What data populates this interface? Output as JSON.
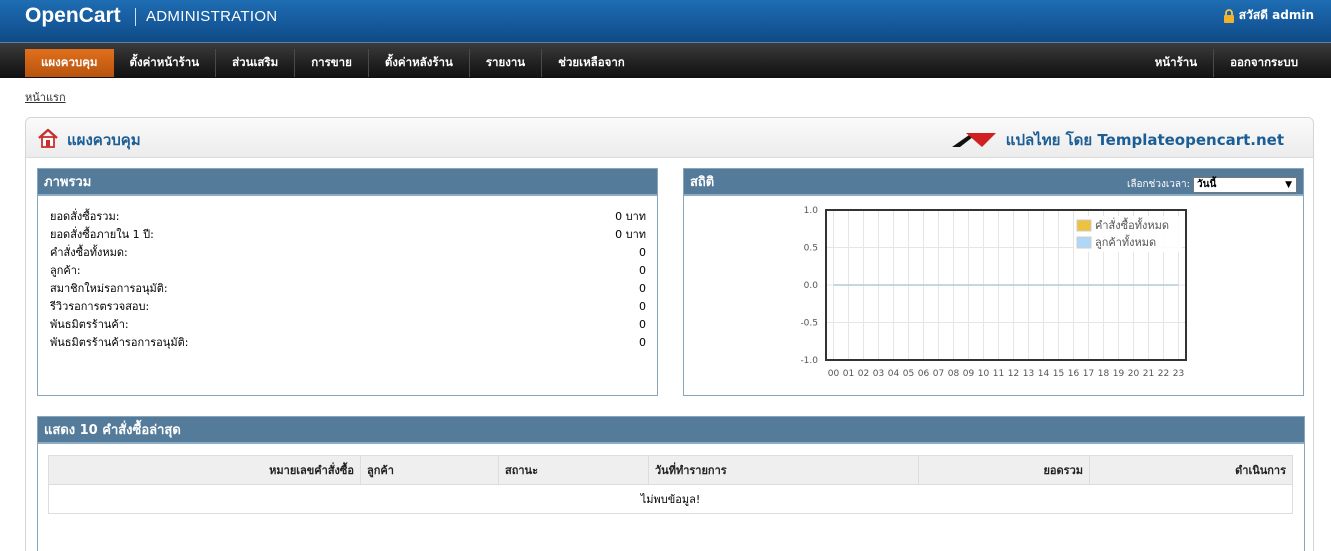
{
  "header": {
    "brand": "OpenCart",
    "subtitle": "ADMINISTRATION",
    "user_greeting": "สวัสดี admin"
  },
  "menu": {
    "items": [
      {
        "label": "แผงควบคุม",
        "active": true
      },
      {
        "label": "ตั้งค่าหน้าร้าน"
      },
      {
        "label": "ส่วนเสริม"
      },
      {
        "label": "การขาย"
      },
      {
        "label": "ตั้งค่าหลังร้าน"
      },
      {
        "label": "รายงาน"
      },
      {
        "label": "ช่วยเหลือจาก"
      }
    ],
    "right": [
      {
        "label": "หน้าร้าน"
      },
      {
        "label": "ออกจากระบบ"
      }
    ]
  },
  "breadcrumb": "หน้าแรก",
  "dashboard": {
    "title": "แผงควบคุม",
    "credit": "แปลไทย โดย Templateopencart.net"
  },
  "overview": {
    "title": "ภาพรวม",
    "rows": [
      {
        "label": "ยอดสั่งซื้อรวม:",
        "value": "0 บาท"
      },
      {
        "label": "ยอดสั่งซื้อภายใน 1 ปี:",
        "value": "0 บาท"
      },
      {
        "label": "คำสั่งซื้อทั้งหมด:",
        "value": "0"
      },
      {
        "label": "ลูกค้า:",
        "value": "0"
      },
      {
        "label": "สมาชิกใหม่รอการอนุมัติ:",
        "value": "0"
      },
      {
        "label": "รีวิวรอการตรวจสอบ:",
        "value": "0"
      },
      {
        "label": "พันธมิตรร้านค้า:",
        "value": "0"
      },
      {
        "label": "พันธมิตรร้านค้ารอการอนุมัติ:",
        "value": "0"
      }
    ]
  },
  "stats": {
    "title": "สถิติ",
    "range_label": "เลือกช่วงเวลา:",
    "range_value": "วันนี้"
  },
  "chart_data": {
    "type": "line",
    "x": [
      "00",
      "01",
      "02",
      "03",
      "04",
      "05",
      "06",
      "07",
      "08",
      "09",
      "10",
      "11",
      "12",
      "13",
      "14",
      "15",
      "16",
      "17",
      "18",
      "19",
      "20",
      "21",
      "22",
      "23"
    ],
    "series": [
      {
        "name": "คำสั่งซื้อทั้งหมด",
        "color": "#edc240",
        "values": [
          0,
          0,
          0,
          0,
          0,
          0,
          0,
          0,
          0,
          0,
          0,
          0,
          0,
          0,
          0,
          0,
          0,
          0,
          0,
          0,
          0,
          0,
          0,
          0
        ]
      },
      {
        "name": "ลูกค้าทั้งหมด",
        "color": "#afd8f8",
        "values": [
          0,
          0,
          0,
          0,
          0,
          0,
          0,
          0,
          0,
          0,
          0,
          0,
          0,
          0,
          0,
          0,
          0,
          0,
          0,
          0,
          0,
          0,
          0,
          0
        ]
      }
    ],
    "y_ticks": [
      "1.0",
      "0.5",
      "0.0",
      "-0.5",
      "-1.0"
    ],
    "ylim": [
      -1.0,
      1.0
    ],
    "grid": true,
    "legend": "top-right"
  },
  "orders": {
    "title": "แสดง 10 คำสั่งซื้อล่าสุด",
    "columns": [
      "หมายเลขคำสั่งซื้อ",
      "ลูกค้า",
      "สถานะ",
      "วันที่ทำรายการ",
      "ยอดรวม",
      "ดำเนินการ"
    ],
    "empty_text": "ไม่พบข้อมูล!"
  }
}
